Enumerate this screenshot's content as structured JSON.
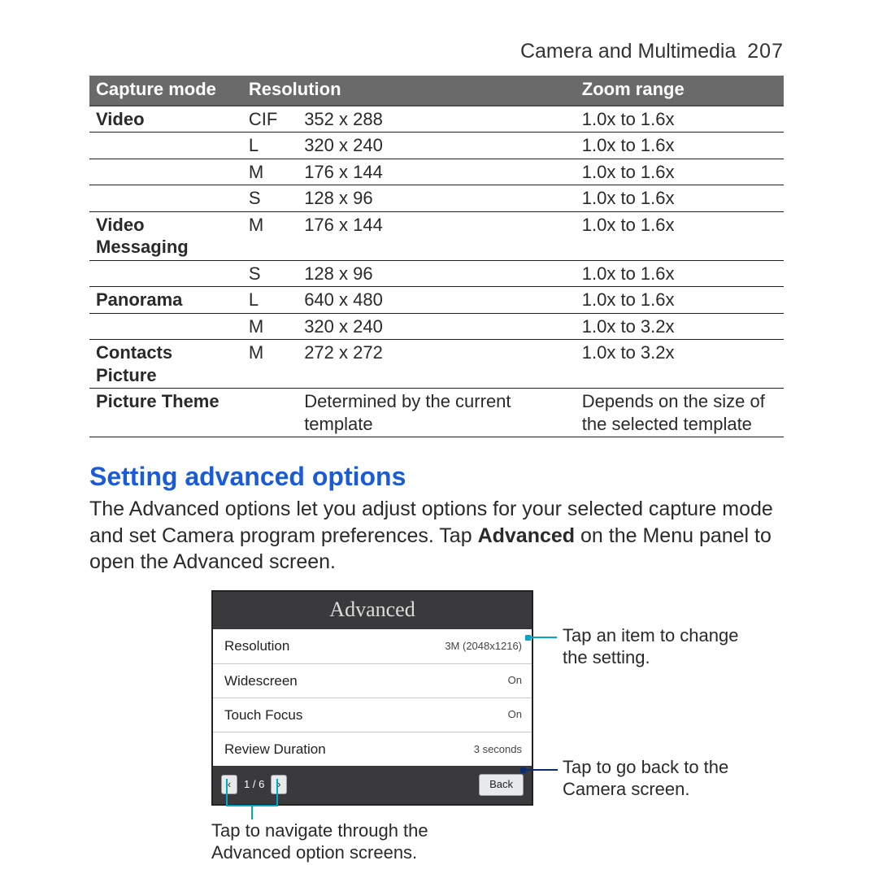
{
  "header": {
    "section": "Camera and Multimedia",
    "page": "207"
  },
  "table": {
    "columns": [
      "Capture mode",
      "Resolution",
      "Zoom range"
    ],
    "rows": [
      {
        "mode": "Video",
        "code": "CIF",
        "res": "352 x 288",
        "zoom": "1.0x to 1.6x"
      },
      {
        "mode": "",
        "code": "L",
        "res": "320 x 240",
        "zoom": "1.0x to 1.6x"
      },
      {
        "mode": "",
        "code": "M",
        "res": "176 x 144",
        "zoom": "1.0x to 1.6x"
      },
      {
        "mode": "",
        "code": "S",
        "res": "128 x 96",
        "zoom": "1.0x to 1.6x"
      },
      {
        "mode": "Video Messaging",
        "code": "M",
        "res": "176 x 144",
        "zoom": "1.0x to 1.6x"
      },
      {
        "mode": "",
        "code": "S",
        "res": "128 x 96",
        "zoom": "1.0x to 1.6x"
      },
      {
        "mode": "Panorama",
        "code": "L",
        "res": "640 x 480",
        "zoom": "1.0x to 1.6x"
      },
      {
        "mode": "",
        "code": "M",
        "res": "320 x 240",
        "zoom": "1.0x to 3.2x"
      },
      {
        "mode": "Contacts Picture",
        "code": "M",
        "res": "272 x 272",
        "zoom": "1.0x to 3.2x"
      },
      {
        "mode": "Picture Theme",
        "code": "",
        "res": "Determined by the current template",
        "zoom": "Depends on the size of the selected template"
      }
    ]
  },
  "section_title": "Setting advanced options",
  "body_text_1": "The Advanced options let you adjust options for your selected capture mode and set Camera program preferences. Tap ",
  "body_text_bold": "Advanced",
  "body_text_2": " on the Menu panel to open the Advanced screen.",
  "advanced_screen": {
    "title": "Advanced",
    "items": [
      {
        "label": "Resolution",
        "value": "3M (2048x1216)"
      },
      {
        "label": "Widescreen",
        "value": "On"
      },
      {
        "label": "Touch Focus",
        "value": "On"
      },
      {
        "label": "Review Duration",
        "value": "3 seconds"
      }
    ],
    "pager_prev": "‹",
    "pager_count": "1 / 6",
    "pager_next": "›",
    "back_label": "Back"
  },
  "callouts": {
    "item": "Tap an item to change the setting.",
    "back": "Tap to go back to the Camera screen.",
    "pager": "Tap to navigate through the Advanced option screens."
  }
}
